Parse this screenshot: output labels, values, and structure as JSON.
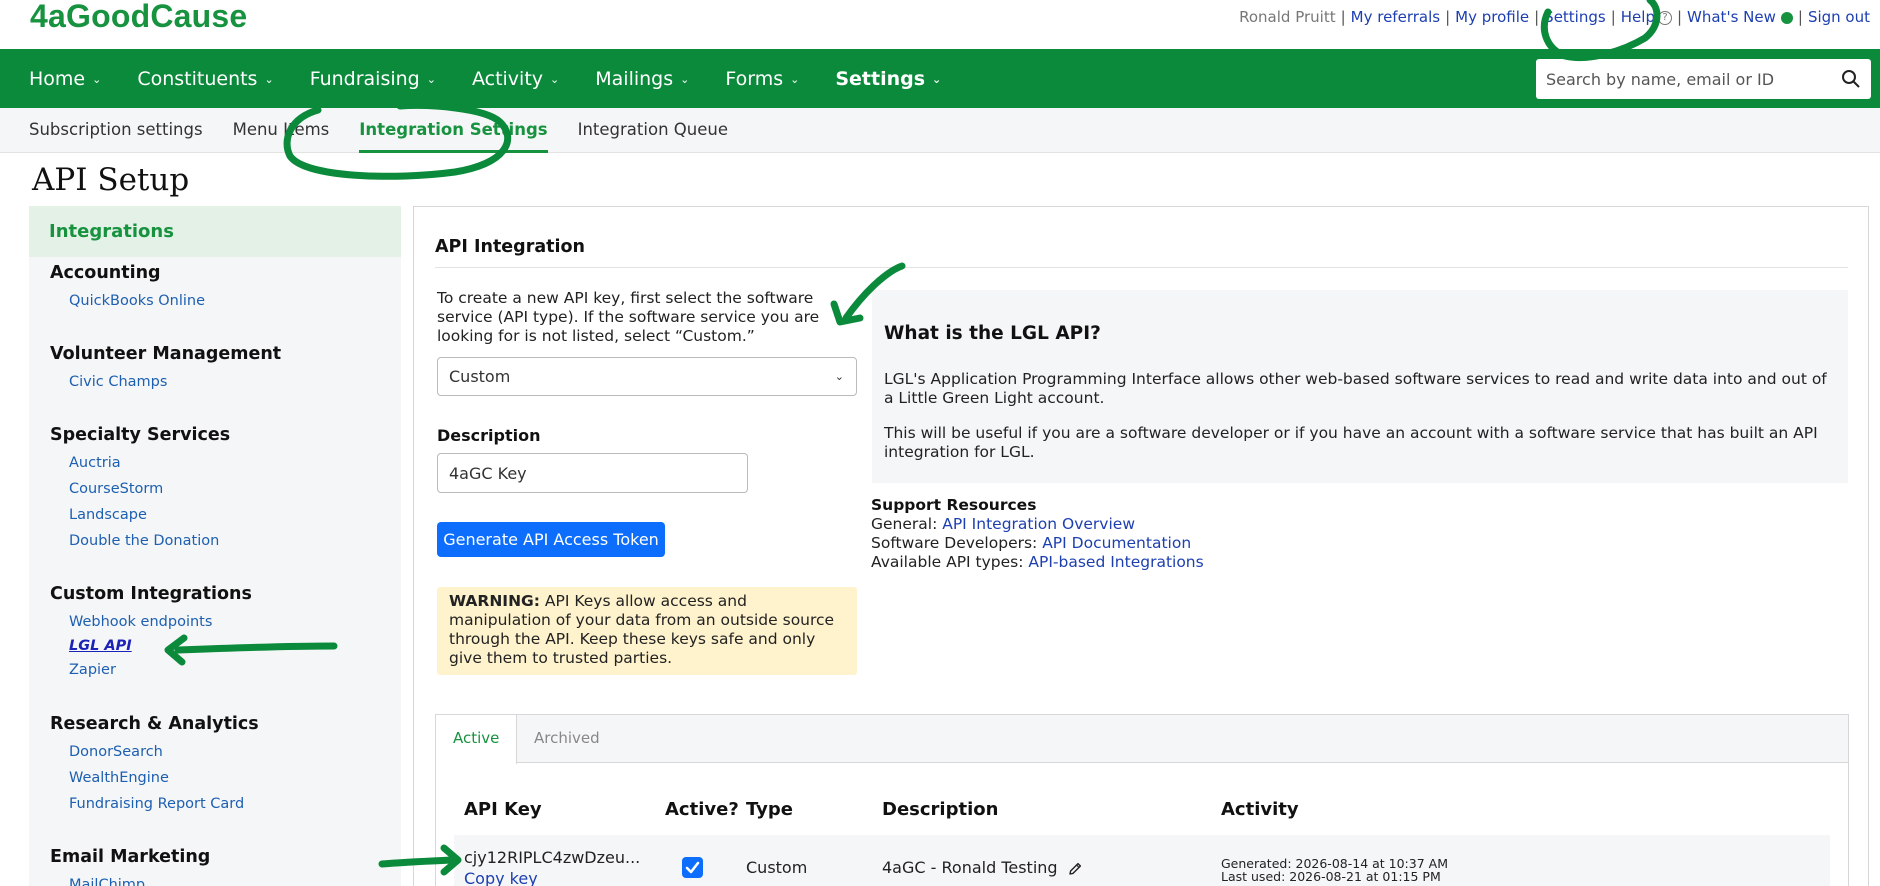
{
  "app": {
    "logo": "4aGoodCause"
  },
  "top_links": {
    "user": "Ronald Pruitt",
    "my_referrals": "My referrals",
    "my_profile": "My profile",
    "settings": "Settings",
    "help": "Help",
    "whats_new": "What's New",
    "sign_out": "Sign out"
  },
  "nav": {
    "items": [
      {
        "label": "Home"
      },
      {
        "label": "Constituents"
      },
      {
        "label": "Fundraising"
      },
      {
        "label": "Activity"
      },
      {
        "label": "Mailings"
      },
      {
        "label": "Forms"
      },
      {
        "label": "Settings"
      }
    ],
    "search_placeholder": "Search by name, email or ID"
  },
  "subnav": {
    "items": [
      {
        "label": "Subscription settings"
      },
      {
        "label": "Menu Items"
      },
      {
        "label": "Integration Settings"
      },
      {
        "label": "Integration Queue"
      }
    ]
  },
  "page": {
    "title": "API Setup"
  },
  "sidebar": {
    "header": "Integrations",
    "sections": [
      {
        "title": "Accounting",
        "links": [
          "QuickBooks Online"
        ]
      },
      {
        "title": "Volunteer Management",
        "links": [
          "Civic Champs"
        ]
      },
      {
        "title": "Specialty Services",
        "links": [
          "Auctria",
          "CourseStorm",
          "Landscape",
          "Double the Donation"
        ]
      },
      {
        "title": "Custom Integrations",
        "links": [
          "Webhook endpoints",
          "LGL API",
          "Zapier"
        ]
      },
      {
        "title": "Research & Analytics",
        "links": [
          "DonorSearch",
          "WealthEngine",
          "Fundraising Report Card"
        ]
      },
      {
        "title": "Email Marketing",
        "links": [
          "MailChimp"
        ]
      }
    ]
  },
  "panel": {
    "title": "API Integration",
    "intro": "To create a new API key, first select the software service (API type). If the software service you are looking for is not listed, select “Custom.”",
    "select_value": "Custom",
    "description_label": "Description",
    "description_value": "4aGC Key",
    "generate_button": "Generate API Access Token",
    "warning_label": "WARNING:",
    "warning_text": " API Keys allow access and manipulation of your data from an outside source through the API. Keep these keys safe and only give them to trusted parties.",
    "info": {
      "title": "What is the LGL API?",
      "p1": "LGL's Application Programming Interface allows other web-based software services to read and write data into and out of a Little Green Light account.",
      "p2": "This will be useful if you are a software developer or if you have an account with a software service that has built an API integration for LGL."
    },
    "support": {
      "title": "Support Resources",
      "general_label": "General: ",
      "general_link": "API Integration Overview",
      "dev_label": "Software Developers: ",
      "dev_link": "API Documentation",
      "types_label": "Available API types: ",
      "types_link": "API-based Integrations"
    }
  },
  "keys": {
    "tabs": [
      "Active",
      "Archived"
    ],
    "columns": [
      "API Key",
      "Active?",
      "Type",
      "Description",
      "Activity"
    ],
    "rows": [
      {
        "key": "cjy12RIPLC4zwDzeu...",
        "copy": "Copy key",
        "active": true,
        "type": "Custom",
        "description": "4aGC - Ronald Testing",
        "generated": "Generated: 2026-08-14 at 10:37 AM",
        "last_used": "Last used: 2026-08-21 at 01:15 PM"
      }
    ]
  },
  "colors": {
    "brand_green": "#0b8a3b",
    "link_blue": "#1d5fb0",
    "button_blue": "#0d6efd",
    "warning_bg": "#fff3cd"
  }
}
